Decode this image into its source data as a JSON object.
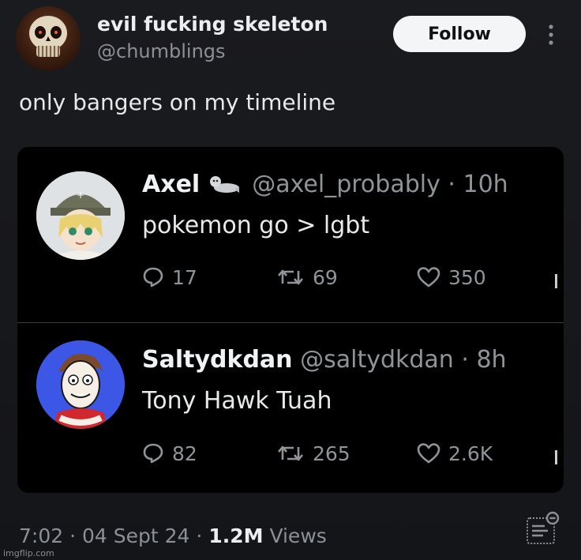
{
  "author": {
    "name": "evil fucking skeleton",
    "handle": "@chumblings",
    "avatar_icon": "skull-avatar"
  },
  "follow_label": "Follow",
  "tweet_text": "only bangers on my timeline",
  "quoted_replies": [
    {
      "name": "Axel",
      "badge_icon": "seal-emoji",
      "handle": "@axel_probably",
      "separator": "·",
      "time": "10h",
      "text": "pokemon go > lgbt",
      "replies": "17",
      "retweets": "69",
      "likes": "350"
    },
    {
      "name": "Saltydkdan",
      "handle": "@saltydkdan",
      "separator": "·",
      "time": "8h",
      "text": "Tony Hawk Tuah",
      "replies": "82",
      "retweets": "265",
      "likes": "2.6K"
    }
  ],
  "footer": {
    "time": "7:02",
    "sep1": "·",
    "date": "04 Sept 24",
    "sep2": "·",
    "views_count": "1.2M",
    "views_label": "Views"
  },
  "watermark": "imgflip.com",
  "colors": {
    "background": "#17181c",
    "card": "#000000",
    "muted": "#8f9499",
    "accent_avatar_blue": "#3c56e6"
  }
}
